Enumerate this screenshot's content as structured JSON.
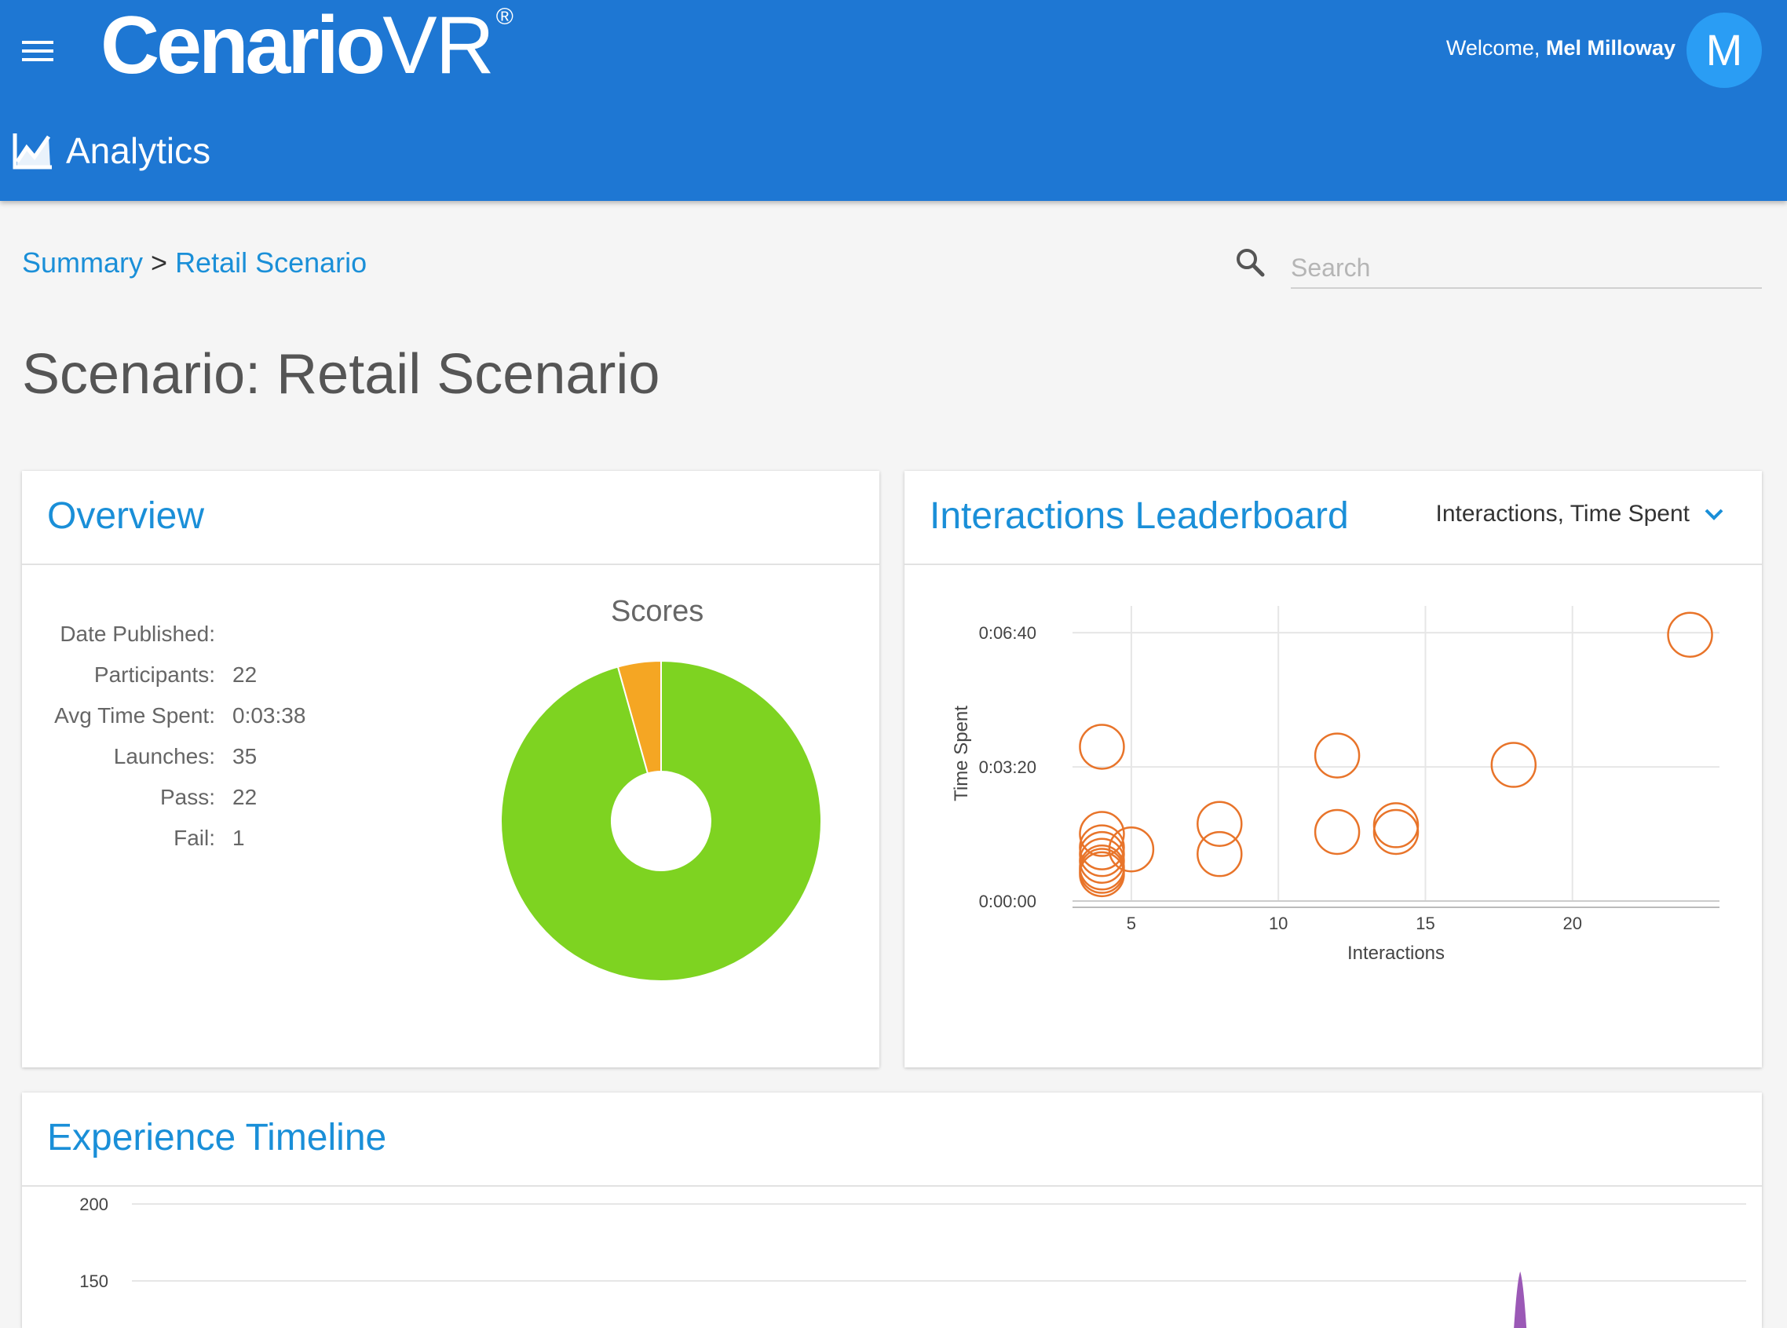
{
  "header": {
    "logo_main": "Cenario",
    "logo_vr": "VR",
    "logo_reg": "®",
    "welcome_prefix": "Welcome,",
    "user_name": "Mel Milloway",
    "avatar_initial": "M",
    "section": "Analytics",
    "menu_icon": "hamburger-menu-icon",
    "section_icon": "line-chart-icon"
  },
  "breadcrumb": {
    "root": "Summary",
    "separator": ">",
    "current": "Retail Scenario"
  },
  "search": {
    "placeholder": "Search",
    "icon": "search-icon"
  },
  "page": {
    "title": "Scenario: Retail Scenario"
  },
  "overview": {
    "title": "Overview",
    "stats": [
      {
        "label": "Date Published:",
        "value": ""
      },
      {
        "label": "Participants:",
        "value": "22"
      },
      {
        "label": "Avg Time Spent:",
        "value": "0:03:38"
      },
      {
        "label": "Launches:",
        "value": "35"
      },
      {
        "label": "Pass:",
        "value": "22"
      },
      {
        "label": "Fail:",
        "value": "1"
      }
    ],
    "scores_title": "Scores"
  },
  "leaderboard": {
    "title": "Interactions Leaderboard",
    "dropdown_label": "Interactions, Time Spent"
  },
  "timeline": {
    "title": "Experience Timeline"
  },
  "colors": {
    "brand_blue": "#1e77d3",
    "link_blue": "#1a8fd8",
    "pass_green": "#7ed321",
    "fail_orange": "#f5a623",
    "point_orange": "#e8742a",
    "timeline_purple": "#9b59b6"
  },
  "chart_data": [
    {
      "type": "pie",
      "title": "Scores",
      "donut": true,
      "values": [
        22,
        1
      ],
      "colors": [
        "#7ed321",
        "#f5a623"
      ]
    },
    {
      "type": "scatter",
      "xlabel": "Interactions",
      "ylabel": "Time Spent",
      "xlim": [
        3,
        25
      ],
      "ylim": [
        0,
        440
      ],
      "x_ticks": [
        5,
        10,
        15,
        20
      ],
      "y_ticks": [
        {
          "value": 0,
          "label": "0:00:00"
        },
        {
          "value": 200,
          "label": "0:03:20"
        },
        {
          "value": 400,
          "label": "0:06:40"
        }
      ],
      "grid": true,
      "points": [
        {
          "x": 4,
          "y": 230
        },
        {
          "x": 4,
          "y": 100
        },
        {
          "x": 4,
          "y": 80
        },
        {
          "x": 4,
          "y": 70
        },
        {
          "x": 4,
          "y": 60
        },
        {
          "x": 4,
          "y": 50
        },
        {
          "x": 4,
          "y": 45
        },
        {
          "x": 4,
          "y": 40
        },
        {
          "x": 5,
          "y": 77
        },
        {
          "x": 8,
          "y": 115
        },
        {
          "x": 8,
          "y": 70
        },
        {
          "x": 12,
          "y": 217
        },
        {
          "x": 12,
          "y": 103
        },
        {
          "x": 14,
          "y": 113
        },
        {
          "x": 14,
          "y": 103
        },
        {
          "x": 18,
          "y": 203
        },
        {
          "x": 24,
          "y": 397
        }
      ]
    },
    {
      "type": "area",
      "y_ticks": [
        200,
        150
      ],
      "ylim": [
        0,
        200
      ],
      "grid": true,
      "visible_peak": {
        "x_fraction": 0.86,
        "y": 150
      }
    }
  ]
}
